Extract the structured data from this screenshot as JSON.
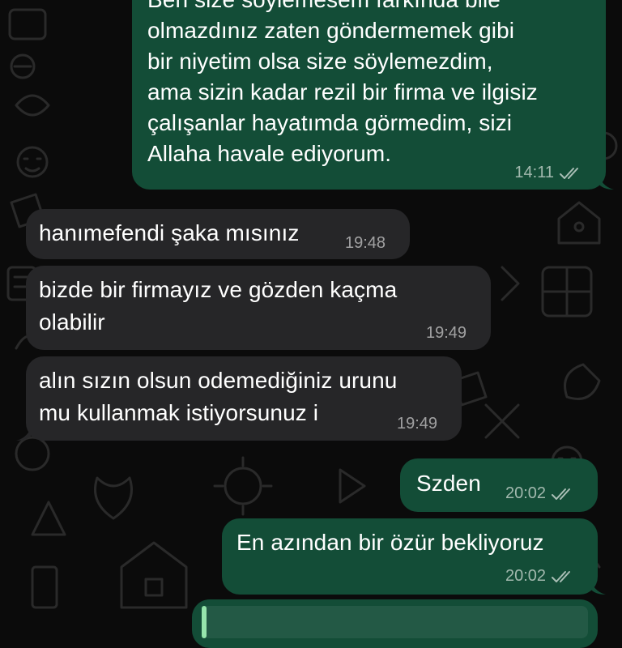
{
  "colors": {
    "background": "#0b0b0b",
    "outgoing_bubble": "#134d37",
    "incoming_bubble": "#262628",
    "reply_accent": "#8fe3a6"
  },
  "messages": [
    {
      "direction": "outgoing",
      "lines": [
        "Ben size söylemesem farkında bile",
        "olmazdınız zaten göndermemek gibi",
        "bir niyetim olsa size söylemezdim,",
        "ama sizin kadar rezil bir firma ve ilgisiz",
        "çalışanlar hayatımda görmedim, sizi",
        "Allaha havale ediyorum."
      ],
      "time": "14:11",
      "status_icon": "double-check-icon"
    },
    {
      "direction": "incoming",
      "lines": [
        "hanımefendi şaka mısınız"
      ],
      "time": "19:48"
    },
    {
      "direction": "incoming",
      "lines": [
        "bizde bir firmayız ve gözden kaçma",
        "olabilir"
      ],
      "time": "19:49"
    },
    {
      "direction": "incoming",
      "lines": [
        "alın sızın olsun odemediğiniz urunu",
        "mu kullanmak istiyorsunuz i"
      ],
      "time": "19:49"
    },
    {
      "direction": "outgoing",
      "lines": [
        "Szden"
      ],
      "time": "20:02",
      "status_icon": "double-check-icon"
    },
    {
      "direction": "outgoing",
      "lines": [
        "En azından bir özür bekliyoruz"
      ],
      "time": "20:02",
      "status_icon": "double-check-icon"
    }
  ]
}
